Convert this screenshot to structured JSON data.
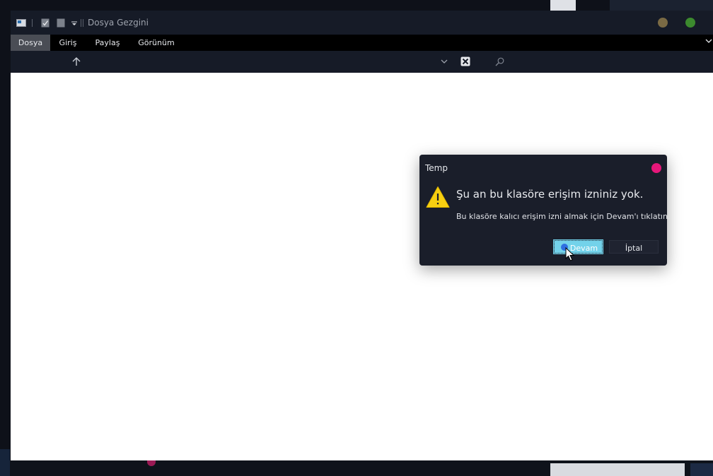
{
  "window": {
    "title": "Dosya Gezgini"
  },
  "quick_access": [
    {
      "name": "properties-icon"
    },
    {
      "name": "checkbox-icon"
    },
    {
      "name": "new-folder-icon"
    },
    {
      "name": "customize-dropdown-icon"
    }
  ],
  "window_controls": {
    "minimize_color": "#7a6a44",
    "maximize_color": "#3c8a2e"
  },
  "ribbon": {
    "tabs": [
      {
        "label": "Dosya",
        "active": true
      },
      {
        "label": "Giriş",
        "active": false
      },
      {
        "label": "Paylaş",
        "active": false
      },
      {
        "label": "Görünüm",
        "active": false
      }
    ]
  },
  "navbar": {
    "icons": [
      "up-arrow-icon",
      "chevron-down-icon",
      "refresh-icon",
      "search-icon"
    ]
  },
  "dialog": {
    "title": "Temp",
    "heading": "Şu an bu klasöre erişim izniniz yok.",
    "body": "Bu klasöre kalıcı erişim izni almak için Devam'ı tıklatın.",
    "continue_label": "Devam",
    "cancel_label": "İptal",
    "close_color": "#e6177a",
    "accent": "#73d2ea"
  }
}
